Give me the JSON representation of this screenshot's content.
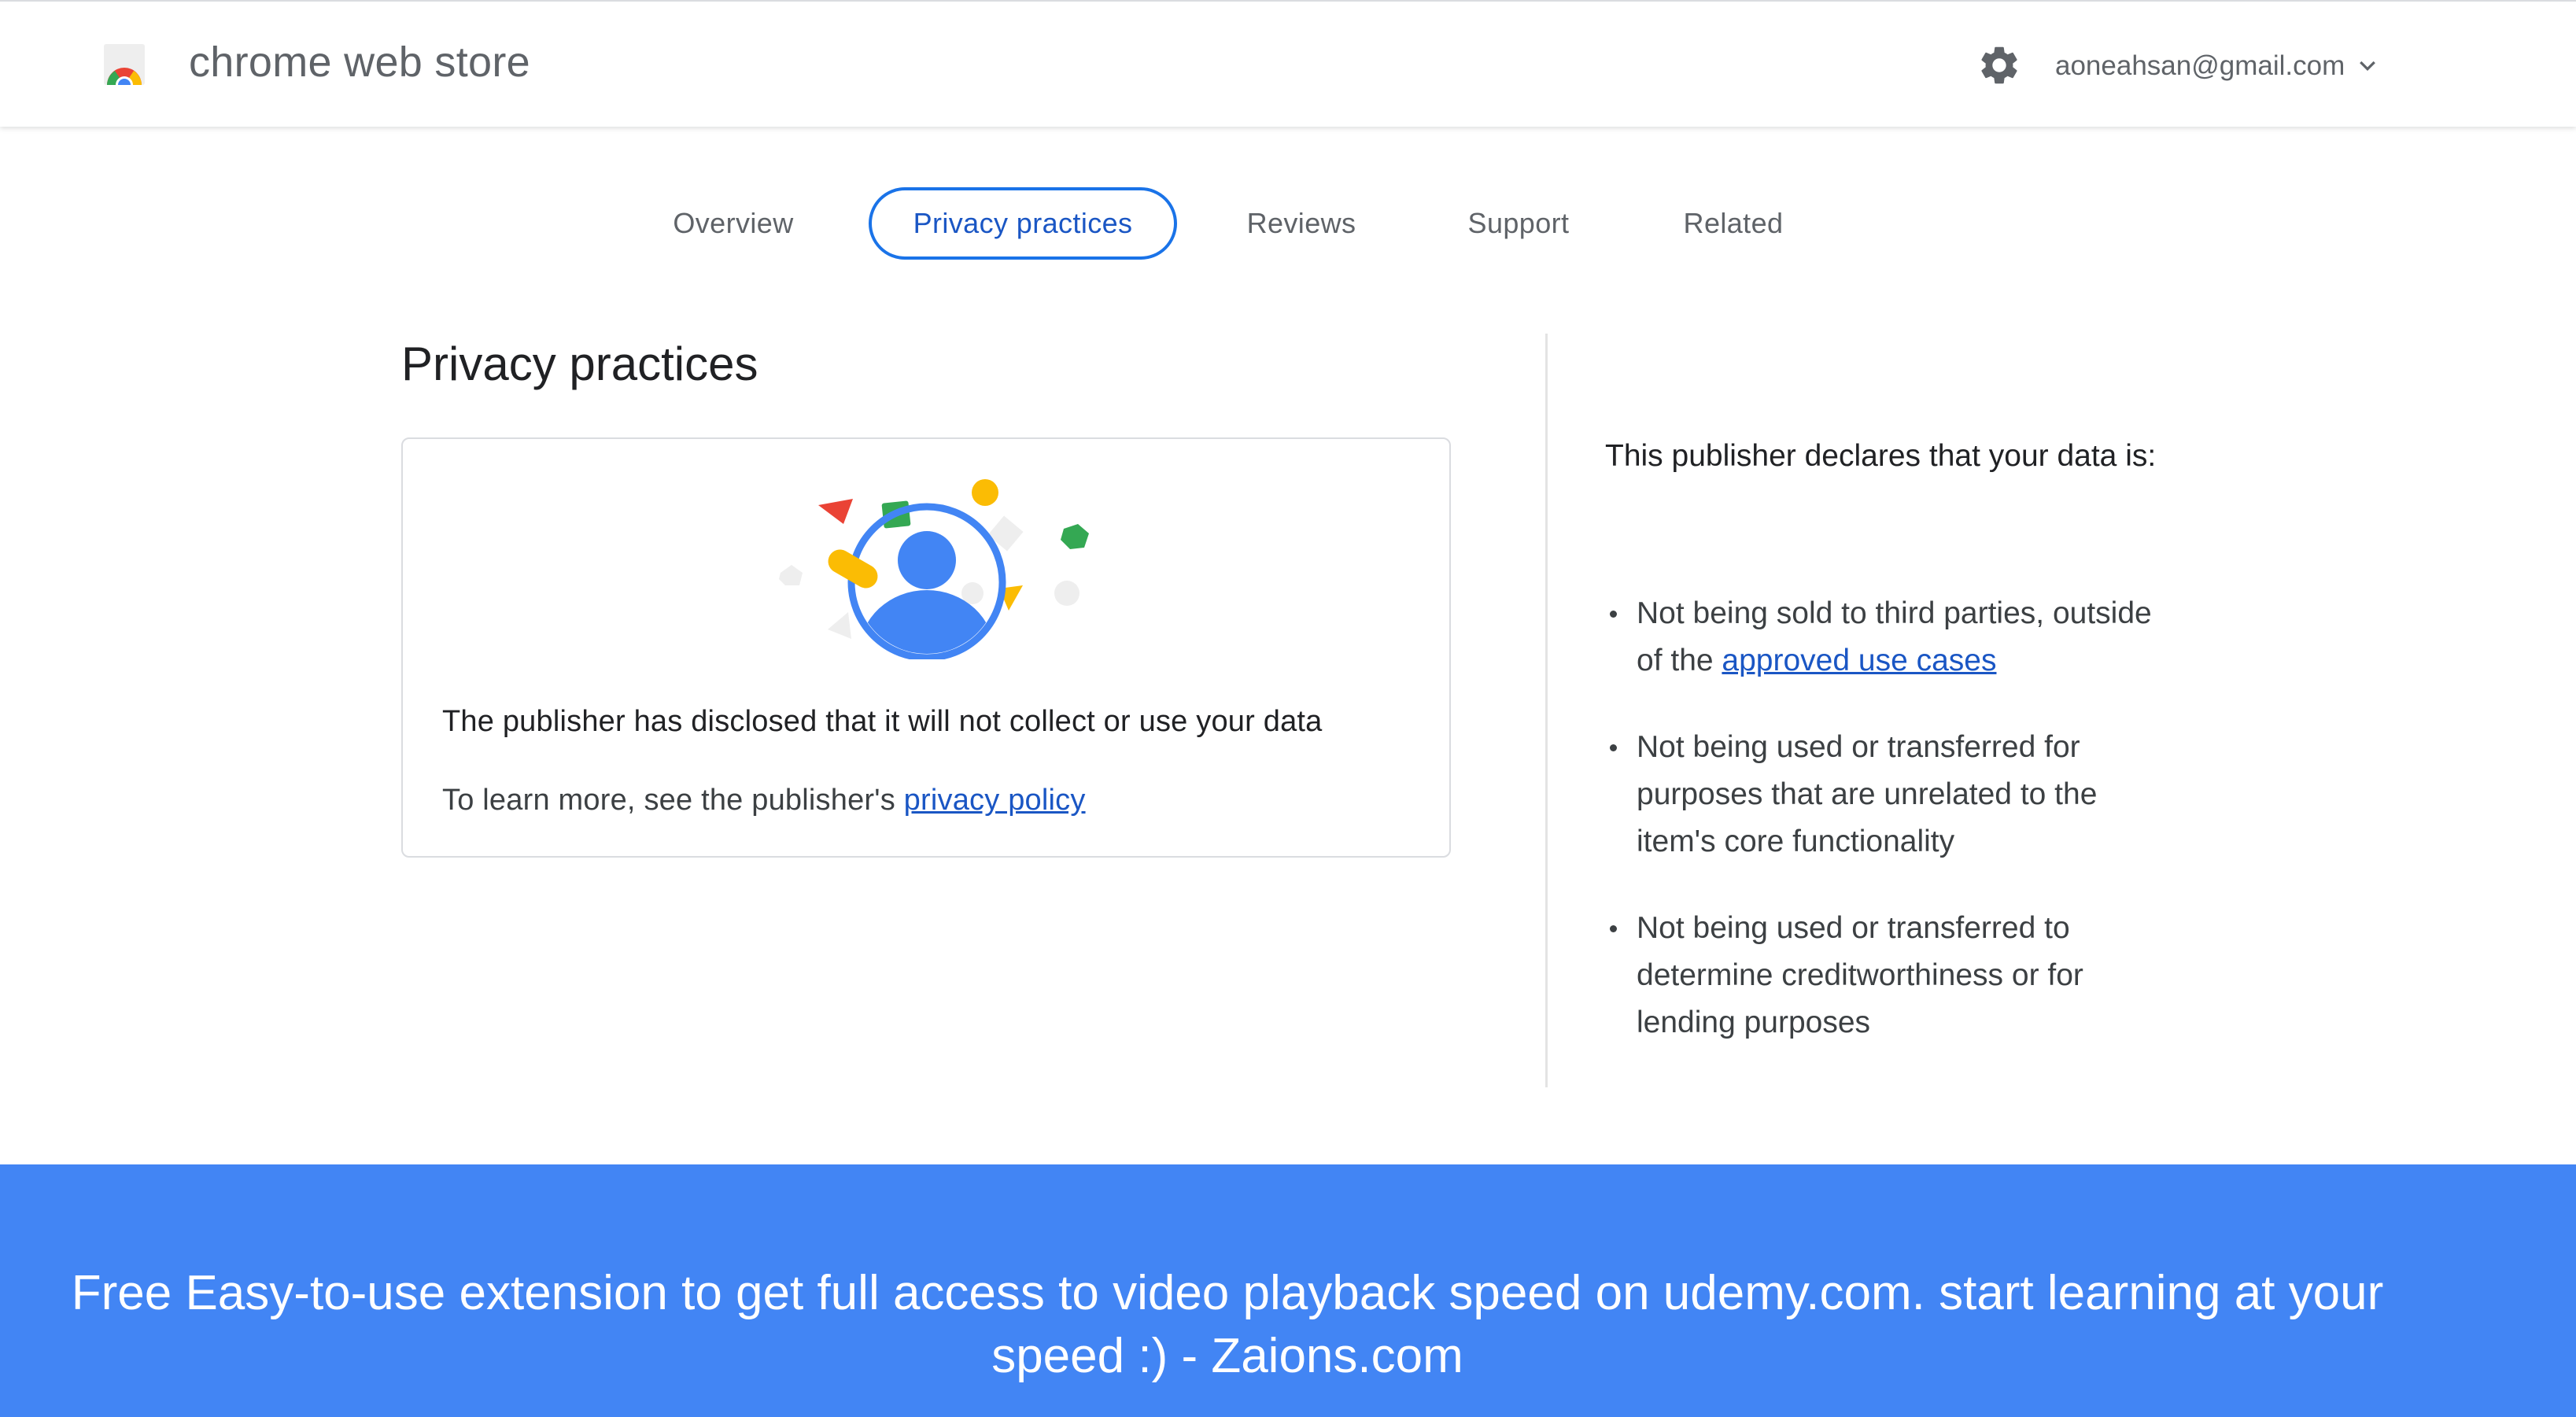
{
  "header": {
    "store_title": "chrome web store",
    "account_email": "aoneahsan@gmail.com"
  },
  "tabs": [
    {
      "label": "Overview",
      "active": false
    },
    {
      "label": "Privacy practices",
      "active": true
    },
    {
      "label": "Reviews",
      "active": false
    },
    {
      "label": "Support",
      "active": false
    },
    {
      "label": "Related",
      "active": false
    }
  ],
  "privacy": {
    "title": "Privacy practices",
    "card_statement": "The publisher has disclosed that it will not collect or use your data",
    "learn_more_prefix": "To learn more, see the publisher's ",
    "privacy_policy_link": "privacy policy"
  },
  "declarations": {
    "intro": "This publisher declares that your data is:",
    "items": [
      {
        "text": "Not being sold to third parties, outside of the ",
        "link": "approved use cases"
      },
      {
        "text": "Not being used or transferred for purposes that are unrelated to the item's core functionality"
      },
      {
        "text": "Not being used or transferred to determine creditworthiness or for lending purposes"
      }
    ]
  },
  "banner": {
    "text": "Free Easy-to-use extension to get full access to video playback speed on udemy.com. start learning at your speed :) - Zaions.com"
  },
  "icons": {
    "logo": "chrome-web-store-logo",
    "settings": "gear-icon",
    "account_menu": "chevron-down-icon",
    "illustration": "privacy-person-illustration"
  },
  "colors": {
    "accent": "#1a73e8",
    "link": "#1a56c4",
    "banner": "#4285f4"
  }
}
